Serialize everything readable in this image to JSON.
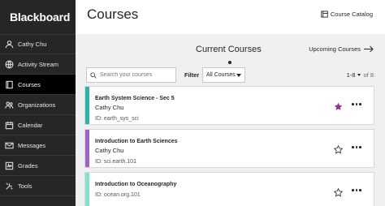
{
  "brand": {
    "name": "Blackboard"
  },
  "sidebar": {
    "items": [
      {
        "label": "Cathy Chu",
        "icon": "user-icon",
        "active": false
      },
      {
        "label": "Activity Stream",
        "icon": "globe-icon",
        "active": false
      },
      {
        "label": "Courses",
        "icon": "book-icon",
        "active": true
      },
      {
        "label": "Organizations",
        "icon": "people-icon",
        "active": false
      },
      {
        "label": "Calendar",
        "icon": "calendar-icon",
        "active": false
      },
      {
        "label": "Messages",
        "icon": "envelope-icon",
        "active": false
      },
      {
        "label": "Grades",
        "icon": "grades-icon",
        "active": false
      },
      {
        "label": "Tools",
        "icon": "tools-icon",
        "active": false
      }
    ]
  },
  "header": {
    "title": "Courses",
    "catalog_label": "Course Catalog"
  },
  "tabs": {
    "current": "Current Courses",
    "upcoming": "Upcoming Courses"
  },
  "filters": {
    "search_placeholder": "Search your courses",
    "filter_label": "Filter",
    "filter_value": "All Courses",
    "pager_range": "1-8",
    "pager_of": "of 8"
  },
  "courses": [
    {
      "title": "Earth System Science - Sec 5",
      "instructor": "Cathy Chu",
      "id": "ID: earth_sys_sci",
      "color": "#2bb3b0",
      "favorite": true
    },
    {
      "title": "Introduction to Earth Sciences",
      "instructor": "Cathy Chu",
      "id": "ID: sci.earth.101",
      "color": "#9f63c7",
      "favorite": false
    },
    {
      "title": "Introduction to Oceanography",
      "instructor": "",
      "id": "ID: ocean.org.101",
      "color": "#7fe3d0",
      "favorite": false
    }
  ],
  "colors": {
    "sidebar_bg": "#262626",
    "active_bg": "#000000",
    "favorite_star": "#9d2a9b",
    "main_bg": "#f0f0f0"
  }
}
